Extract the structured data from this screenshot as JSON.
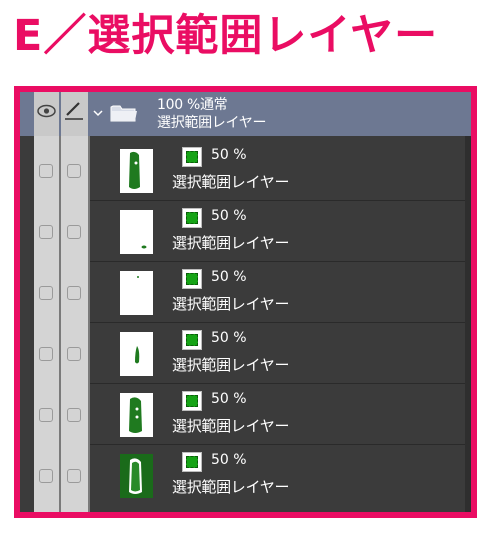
{
  "title": {
    "prefix": "E／",
    "text": "選択範囲レイヤー",
    "color": "#ea0d63",
    "accent_color": "#ea0d63"
  },
  "panel": {
    "border_color": "#ea0d63",
    "folder": {
      "opacity_blend": "100 %通常",
      "name": "選択範囲レイヤー",
      "icons": [
        "eye-icon",
        "pen-icon",
        "chevron-down-icon",
        "folder-icon"
      ],
      "header_color": "#6d7892"
    },
    "layers": [
      {
        "opacity": "50 %",
        "name": "選択範囲レイヤー",
        "thumbnail": "dark-shape"
      },
      {
        "opacity": "50 %",
        "name": "選択範囲レイヤー",
        "thumbnail": "small-dot"
      },
      {
        "opacity": "50 %",
        "name": "選択範囲レイヤー",
        "thumbnail": "tiny-dot"
      },
      {
        "opacity": "50 %",
        "name": "選択範囲レイヤー",
        "thumbnail": "thin-shape"
      },
      {
        "opacity": "50 %",
        "name": "選択範囲レイヤー",
        "thumbnail": "dark-shape"
      },
      {
        "opacity": "50 %",
        "name": "選択範囲レイヤー",
        "thumbnail": "filled-dark"
      }
    ]
  }
}
